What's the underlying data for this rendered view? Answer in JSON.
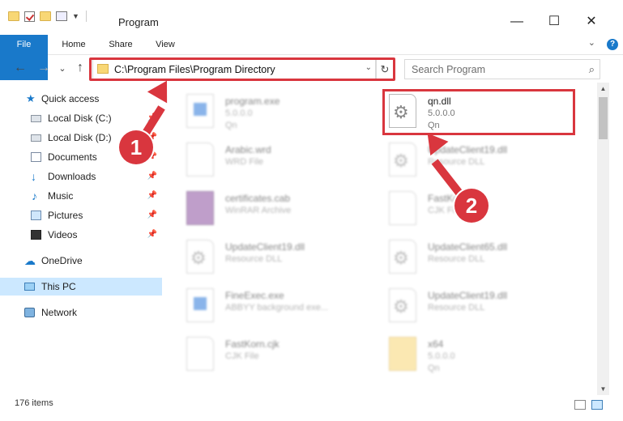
{
  "window": {
    "title": "Program",
    "controls": {
      "minimize": "—",
      "maximize": "☐",
      "close": "✕"
    }
  },
  "ribbon": {
    "tabs": [
      "File",
      "Home",
      "Share",
      "View"
    ],
    "collapse": "⌄",
    "help": "?"
  },
  "navigation": {
    "back": "←",
    "forward": "→",
    "recent": "⌄",
    "up": "↑",
    "address": "C:\\Program Files\\Program Directory",
    "address_dropdown": "⌄",
    "refresh": "↻",
    "search_placeholder": "Search Program",
    "search_icon": "⌕"
  },
  "sidebar": {
    "items": [
      {
        "label": "Quick access",
        "icon": "star-icon",
        "pinned": false
      },
      {
        "label": "Local Disk (C:)",
        "icon": "disk-icon",
        "pinned": true
      },
      {
        "label": "Local Disk (D:)",
        "icon": "disk-icon",
        "pinned": true
      },
      {
        "label": "Documents",
        "icon": "documents-icon",
        "pinned": true
      },
      {
        "label": "Downloads",
        "icon": "download-icon",
        "pinned": true
      },
      {
        "label": "Music",
        "icon": "music-icon",
        "pinned": true
      },
      {
        "label": "Pictures",
        "icon": "pictures-icon",
        "pinned": true
      },
      {
        "label": "Videos",
        "icon": "videos-icon",
        "pinned": true
      },
      {
        "label": "OneDrive",
        "icon": "cloud-icon",
        "pinned": false
      },
      {
        "label": "This PC",
        "icon": "pc-icon",
        "pinned": false,
        "selected": true
      },
      {
        "label": "Network",
        "icon": "network-icon",
        "pinned": false
      }
    ],
    "pin_glyph": "📌"
  },
  "files": [
    {
      "name": "program.exe",
      "line1": "5.0.0.0",
      "line2": "Qn",
      "icon": "exe-icon",
      "blurred": true
    },
    {
      "name": "qn.dll",
      "line1": "5.0.0.0",
      "line2": "Qn",
      "icon": "dll-gear-icon",
      "blurred": false
    },
    {
      "name": "Arabic.wrd",
      "line1": "WRD File",
      "line2": "",
      "icon": "document-icon",
      "blurred": true
    },
    {
      "name": "UpdateClient19.dll",
      "line1": "Resource DLL",
      "line2": "",
      "icon": "dll-gear-icon",
      "blurred": true
    },
    {
      "name": "certificates.cab",
      "line1": "WinRAR Archive",
      "line2": "",
      "icon": "cab-icon",
      "blurred": true
    },
    {
      "name": "FastKorn.cjk",
      "line1": "CJK File",
      "line2": "",
      "icon": "document-icon",
      "blurred": true
    },
    {
      "name": "UpdateClient19.dll",
      "line1": "Resource DLL",
      "line2": "",
      "icon": "dll-gear-icon",
      "blurred": true
    },
    {
      "name": "UpdateClient65.dll",
      "line1": "Resource DLL",
      "line2": "",
      "icon": "dll-gear-icon",
      "blurred": true
    },
    {
      "name": "FineExec.exe",
      "line1": "ABBYY background exe...",
      "line2": "",
      "icon": "exe-icon",
      "blurred": true
    },
    {
      "name": "UpdateClient19.dll",
      "line1": "Resource DLL",
      "line2": "",
      "icon": "dll-gear-icon",
      "blurred": true
    },
    {
      "name": "FastKorn.cjk",
      "line1": "CJK File",
      "line2": "",
      "icon": "document-icon",
      "blurred": true
    },
    {
      "name": "x64",
      "line1": "5.0.0.0",
      "line2": "Qn",
      "icon": "zip-folder-icon",
      "blurred": true
    }
  ],
  "status": {
    "item_count": "176 items"
  },
  "annotations": {
    "callout_1": "1",
    "callout_2": "2",
    "color": "#d9363e"
  }
}
